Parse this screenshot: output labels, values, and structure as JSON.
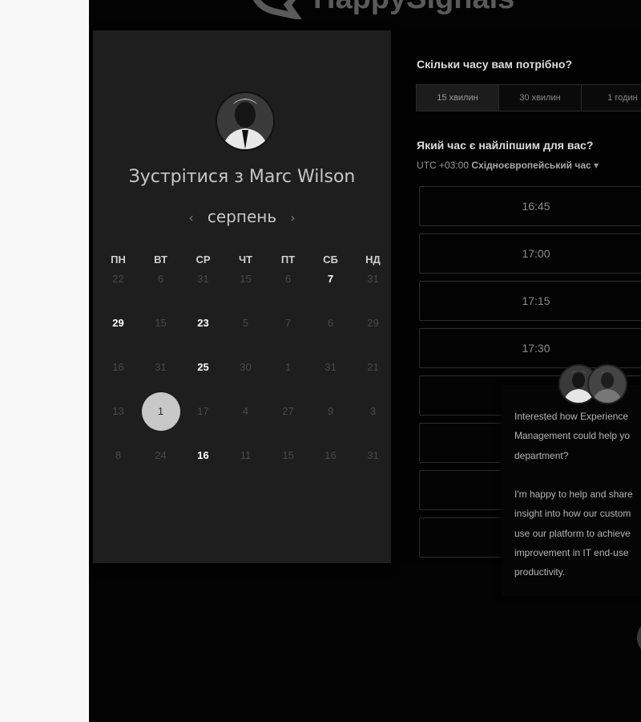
{
  "brand": {
    "name": "HappySignals"
  },
  "host": {
    "title": "Зустрітися з Marc Wilson"
  },
  "calendar": {
    "month": "серпень",
    "prev_arrow": "‹",
    "next_arrow": "›",
    "weekdays": [
      "ПН",
      "ВТ",
      "СР",
      "ЧТ",
      "ПТ",
      "СБ",
      "НД"
    ],
    "weeks": [
      [
        "22",
        "6",
        "31",
        "15",
        "6",
        "7",
        "31"
      ],
      [
        "29",
        "15",
        "23",
        "5",
        "7",
        "6",
        "29"
      ],
      [
        "16",
        "31",
        "25",
        "30",
        "1",
        "31",
        "21"
      ],
      [
        "13",
        "1",
        "17",
        "4",
        "27",
        "9",
        "3"
      ],
      [
        "8",
        "24",
        "16",
        "11",
        "15",
        "16",
        "31"
      ]
    ],
    "active_days": [
      [
        0,
        5
      ],
      [
        1,
        0
      ],
      [
        1,
        2
      ],
      [
        2,
        2
      ],
      [
        4,
        2
      ]
    ],
    "selected_day": [
      3,
      1
    ]
  },
  "duration": {
    "question": "Скільки часу вам потрібно?",
    "options": [
      "15 хвилин",
      "30 хвилин",
      "1 годин"
    ],
    "selected": 0
  },
  "time": {
    "question": "Який час є найліпшим для вас?",
    "tz_offset": "UTC +03:00",
    "tz_name": "Східноєвропейський час",
    "tz_caret": "▾",
    "slots": [
      "16:45",
      "17:00",
      "17:15",
      "17:30",
      "",
      "",
      "",
      ""
    ]
  },
  "chat": {
    "message": "Interested how Experience\nManagement could help yo\ndepartment?\n\nI'm happy to help and share\ninsight into how our custom\nuse our platform to achieve\nimprovement in IT end-use\nproductivity."
  }
}
